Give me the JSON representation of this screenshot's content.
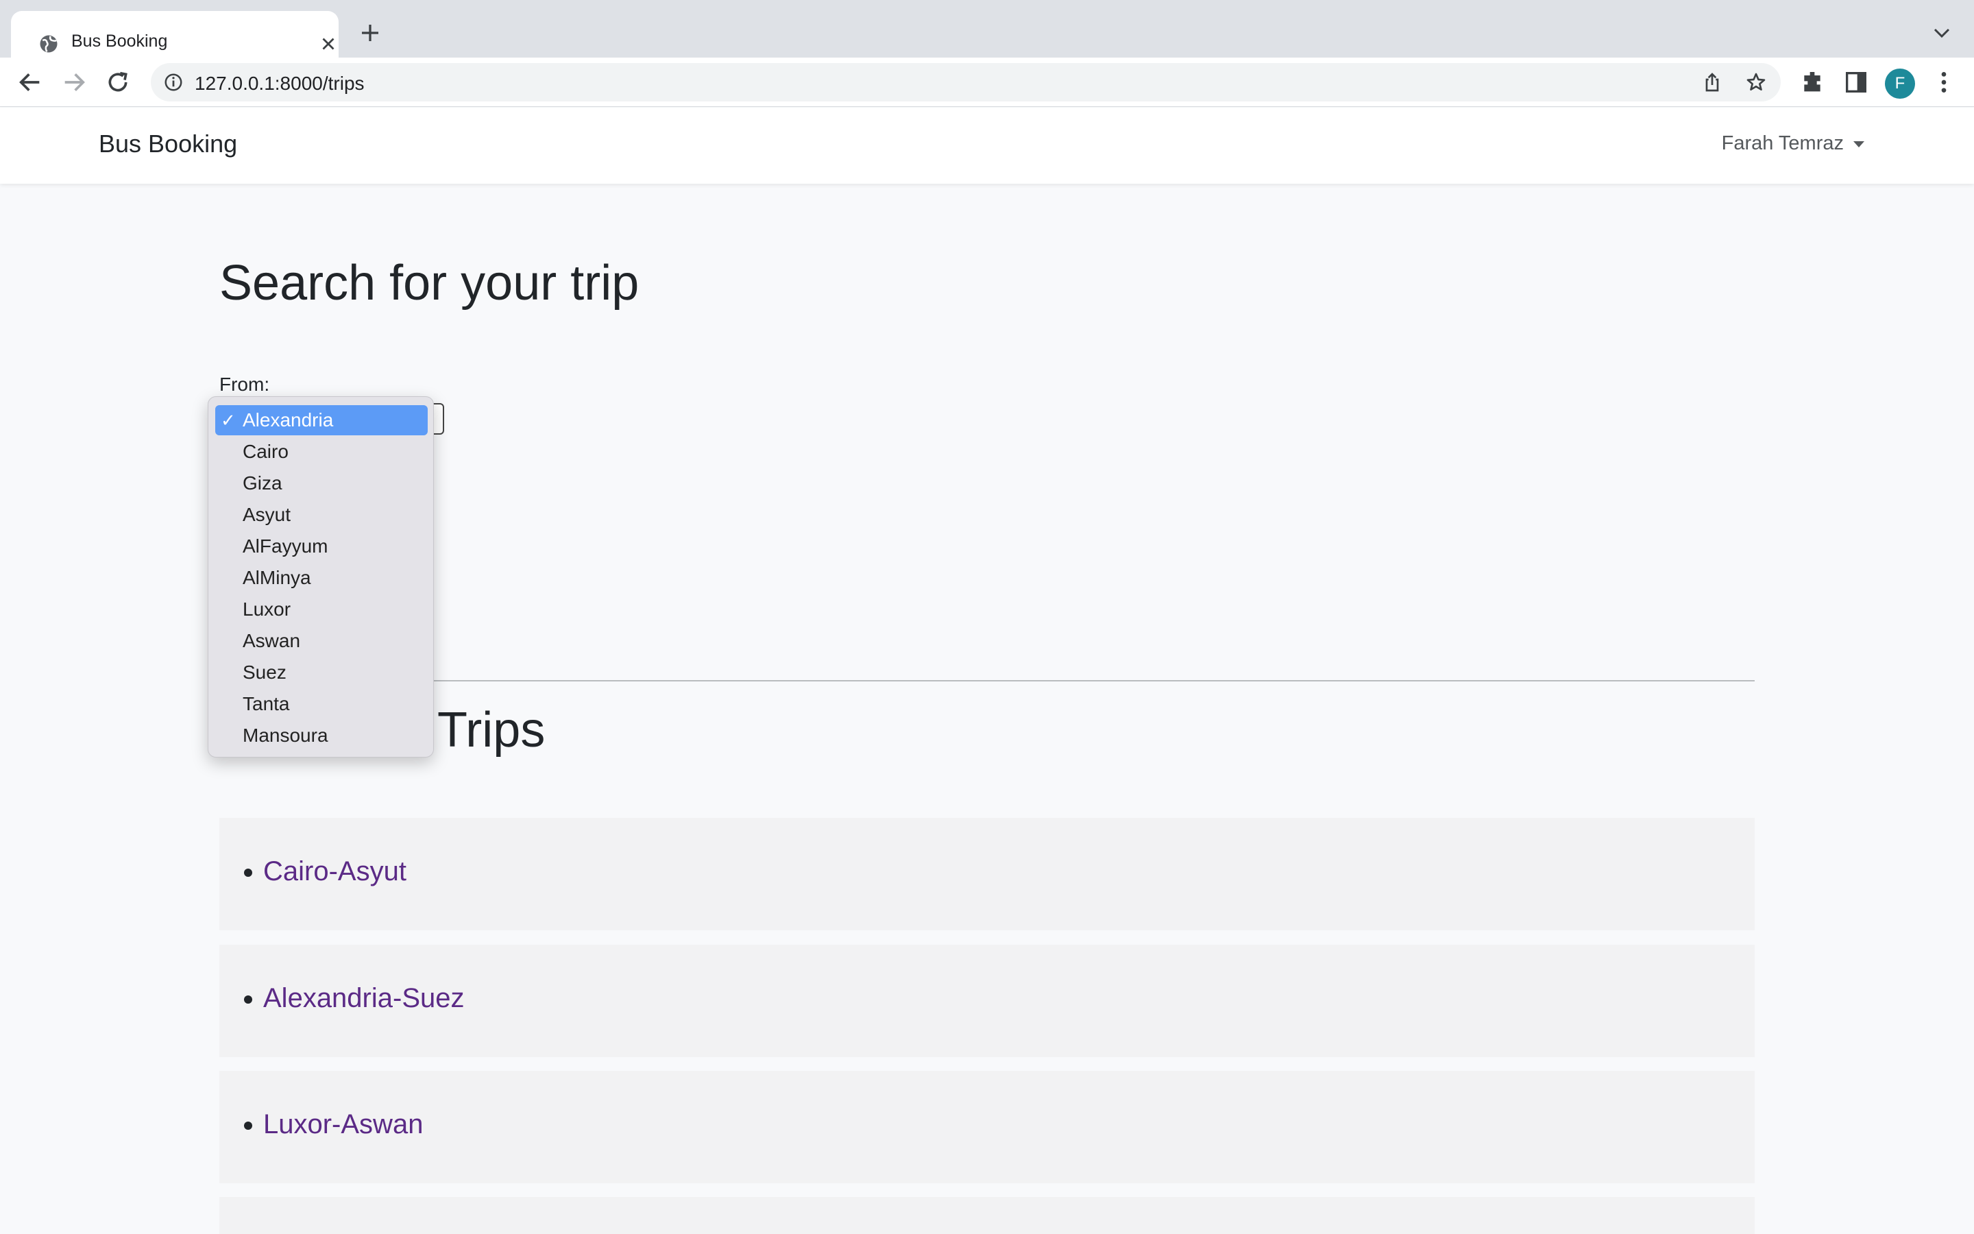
{
  "browser": {
    "tab_title": "Bus Booking",
    "url": "127.0.0.1:8000/trips",
    "profile_initial": "F"
  },
  "navbar": {
    "brand": "Bus Booking",
    "user_name": "Farah Temraz"
  },
  "search": {
    "title": "Search for your trip",
    "from_label": "From:",
    "from_options": [
      "Alexandria",
      "Cairo",
      "Giza",
      "Asyut",
      "AlFayyum",
      "AlMinya",
      "Luxor",
      "Aswan",
      "Suez",
      "Tanta",
      "Mansoura"
    ],
    "selected": "Alexandria"
  },
  "trips": {
    "title": "Trips",
    "items": [
      "Cairo-Asyut",
      "Alexandria-Suez",
      "Luxor-Aswan"
    ]
  },
  "colors": {
    "link": "#5b2a86",
    "selection": "#5c9bf6",
    "avatar": "#1e8a9a"
  }
}
